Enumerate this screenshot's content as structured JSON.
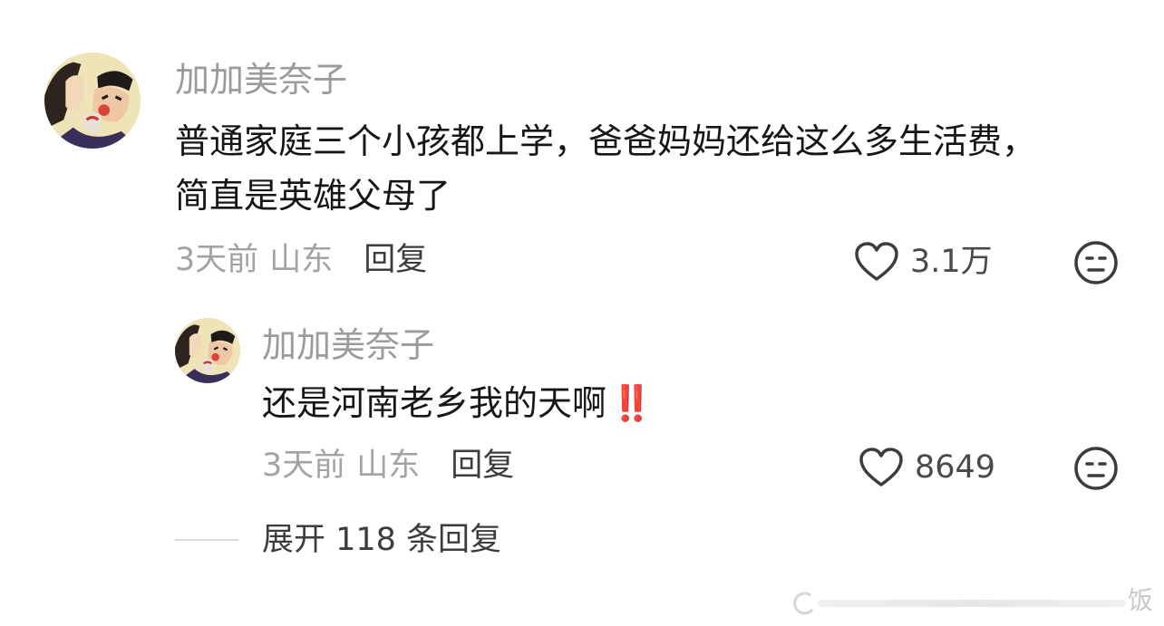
{
  "comment": {
    "username": "加加美奈子",
    "text_line1": "普通家庭三个小孩都上学，爸爸妈妈还给这么多生活费，",
    "text_line2": "简直是英雄父母了",
    "time": "3天前",
    "location": "山东",
    "reply_label": "回复",
    "like_count": "3.1万"
  },
  "reply": {
    "username": "加加美奈子",
    "text": "还是河南老乡我的天啊",
    "emoji": "‼️",
    "time": "3天前",
    "location": "山东",
    "reply_label": "回复",
    "like_count": "8649"
  },
  "expand": {
    "label": "展开 118 条回复"
  },
  "watermark": {
    "text": "饭"
  },
  "colors": {
    "emoji_red": "#e8262d",
    "username_gray": "#9b9b9b",
    "meta_gray": "#a3a3a3"
  },
  "icons": [
    "heart-icon",
    "meh-face-icon"
  ]
}
